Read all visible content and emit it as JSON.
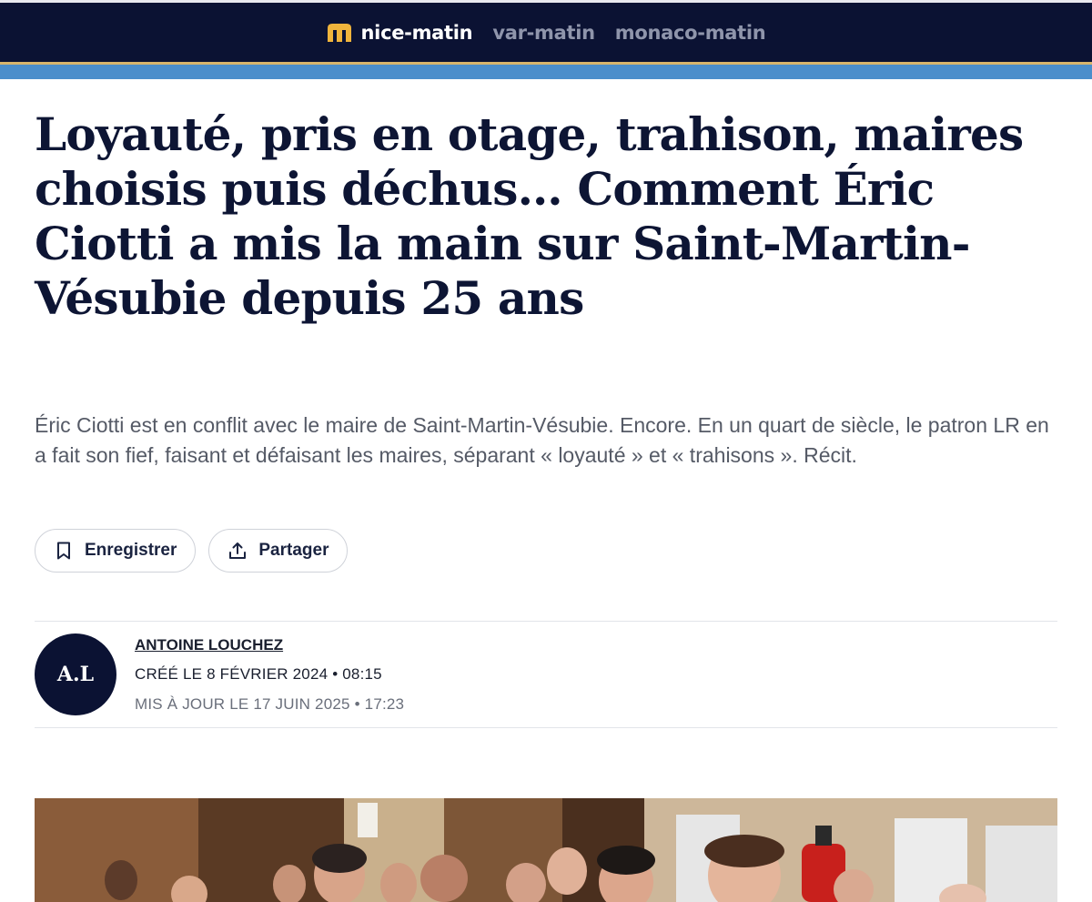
{
  "header": {
    "sites": [
      {
        "label": "nice-matin"
      },
      {
        "label": "var-matin"
      },
      {
        "label": "monaco-matin"
      }
    ],
    "logo_icon": "nice-matin-logo-icon",
    "brand_color": "#0b1233",
    "accent_gold": "#d7b56d",
    "accent_blue": "#4b8ecb",
    "logo_color": "#f0b43c"
  },
  "article": {
    "title": "Loyauté, pris en otage, trahison, maires choisis puis déchus… Comment Éric Ciotti a mis la main sur Saint-Martin-Vésubie depuis 25 ans",
    "lede": "Éric Ciotti est en conflit avec le maire de Saint-Martin-Vésubie. Encore. En un quart de siècle, le patron LR en a fait son fief, faisant et défaisant les maires, séparant « loyauté » et « trahisons ». Récit."
  },
  "actions": {
    "save_label": "Enregistrer",
    "save_icon": "bookmark-icon",
    "share_label": "Partager",
    "share_icon": "share-icon"
  },
  "byline": {
    "initials": "A.L",
    "author": "ANTOINE LOUCHEZ",
    "created": "CRÉÉ LE 8 FÉVRIER 2024 • 08:15",
    "updated": "MIS À JOUR LE 17 JUIN 2025 • 17:23"
  }
}
